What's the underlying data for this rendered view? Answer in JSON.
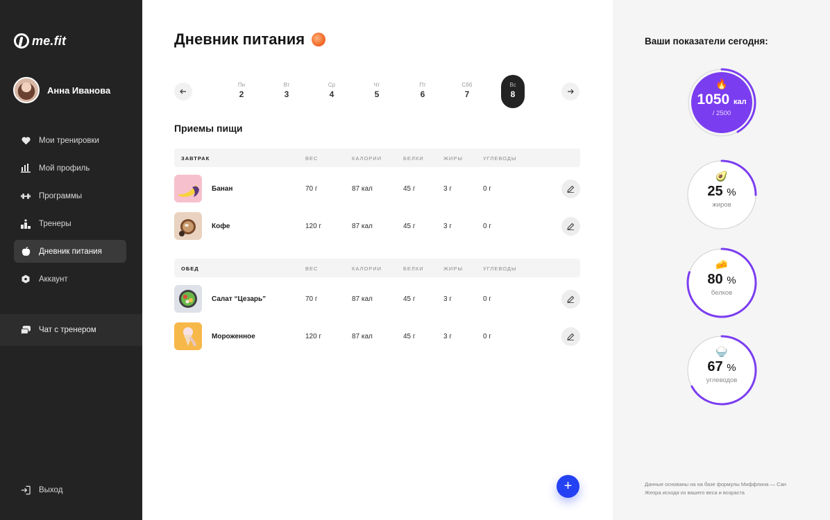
{
  "app": {
    "logo_text": "me.fit"
  },
  "user": {
    "name": "Анна Иванова"
  },
  "sidebar": {
    "items": [
      {
        "label": "Мои тренировки",
        "icon": "heart-icon"
      },
      {
        "label": "Мой профиль",
        "icon": "bar-chart-icon"
      },
      {
        "label": "Программы",
        "icon": "dumbbell-icon"
      },
      {
        "label": "Тренеры",
        "icon": "podium-icon"
      },
      {
        "label": "Дневник питания",
        "icon": "apple-icon",
        "active": true
      },
      {
        "label": "Аккаунт",
        "icon": "shield-icon"
      }
    ],
    "chat_label": "Чат с тренером",
    "logout_label": "Выход"
  },
  "main": {
    "title": "Дневник питания",
    "title_icon": "peach-icon",
    "days": [
      {
        "name": "Пн",
        "num": "2"
      },
      {
        "name": "Вт",
        "num": "3"
      },
      {
        "name": "Ср",
        "num": "4"
      },
      {
        "name": "Чт",
        "num": "5"
      },
      {
        "name": "Пт",
        "num": "6"
      },
      {
        "name": "Сбб",
        "num": "7"
      },
      {
        "name": "Вс",
        "num": "8",
        "active": true
      }
    ],
    "section_title": "Приемы пищи",
    "columns": {
      "weight": "ВЕС",
      "calories": "КАЛОРИИ",
      "protein": "БЕЛКИ",
      "fat": "ЖИРЫ",
      "carbs": "УГЛЕВОДЫ"
    },
    "meals": [
      {
        "name": "ЗАВТРАК",
        "items": [
          {
            "name": "Банан",
            "weight": "70 г",
            "calories": "87 кал",
            "protein": "45 г",
            "fat": "3 г",
            "carbs": "0 г"
          },
          {
            "name": "Кофе",
            "weight": "120 г",
            "calories": "87 кал",
            "protein": "45 г",
            "fat": "3 г",
            "carbs": "0 г"
          }
        ]
      },
      {
        "name": "ОБЕД",
        "items": [
          {
            "name": "Салат “Цезарь”",
            "weight": "70 г",
            "calories": "87 кал",
            "protein": "45 г",
            "fat": "3 г",
            "carbs": "0 г"
          },
          {
            "name": "Мороженное",
            "weight": "120 г",
            "calories": "87 кал",
            "protein": "45 г",
            "fat": "3 г",
            "carbs": "0 г"
          }
        ]
      }
    ],
    "add_label": "+"
  },
  "stats": {
    "title": "Ваши показатели сегодня:",
    "calories": {
      "value": "1050",
      "unit": "кал",
      "total": "/ 2500",
      "progress": 0.42
    },
    "fat": {
      "value": "25",
      "unit": "%",
      "label": "жиров",
      "progress": 0.25
    },
    "protein": {
      "value": "80",
      "unit": "%",
      "label": "белков",
      "progress": 0.8
    },
    "carbs": {
      "value": "67",
      "unit": "%",
      "label": "углеводов",
      "progress": 0.67
    },
    "footnote": "Данные основаны на на базе формулы Миффлина — Сан Жеора исходя из вашего веса и возраста"
  },
  "colors": {
    "accent": "#7b3df0",
    "fab": "#2441f3",
    "sidebar": "#232323"
  }
}
